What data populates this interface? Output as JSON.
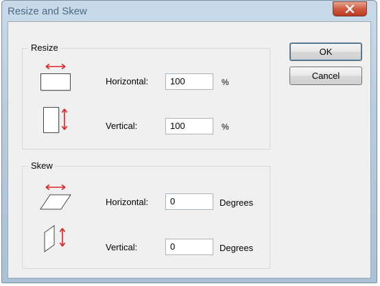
{
  "window": {
    "title": "Resize and Skew",
    "close_label": "X"
  },
  "resize": {
    "legend": "Resize",
    "horizontal": {
      "label": "Horizontal:",
      "value": "100",
      "unit": "%"
    },
    "vertical": {
      "label": "Vertical:",
      "value": "100",
      "unit": "%"
    }
  },
  "skew": {
    "legend": "Skew",
    "horizontal": {
      "label": "Horizontal:",
      "value": "0",
      "unit": "Degrees"
    },
    "vertical": {
      "label": "Vertical:",
      "value": "0",
      "unit": "Degrees"
    }
  },
  "buttons": {
    "ok": "OK",
    "cancel": "Cancel"
  },
  "icons": {
    "resize_horizontal": "resize-horizontal-icon",
    "resize_vertical": "resize-vertical-icon",
    "skew_horizontal": "skew-horizontal-icon",
    "skew_vertical": "skew-vertical-icon"
  },
  "colors": {
    "arrow": "#e02020"
  }
}
